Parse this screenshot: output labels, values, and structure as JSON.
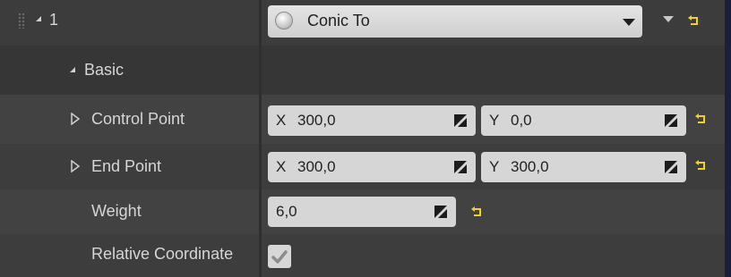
{
  "header": {
    "index_label": "1",
    "type_value": "Conic To"
  },
  "category": {
    "label": "Basic"
  },
  "properties": {
    "control_point": {
      "label": "Control Point",
      "x_axis": "X",
      "x_value": "300,0",
      "y_axis": "Y",
      "y_value": "0,0"
    },
    "end_point": {
      "label": "End Point",
      "x_axis": "X",
      "x_value": "300,0",
      "y_axis": "Y",
      "y_value": "300,0"
    },
    "weight": {
      "label": "Weight",
      "value": "6,0"
    },
    "relative_coordinates": {
      "label": "Relative Coordinate",
      "checked": true
    }
  },
  "colors": {
    "reset_arrow": "#f0d21c",
    "panel": "#4a4a4a",
    "field": "#d6d6d6",
    "frame": "#19203a"
  },
  "icons": [
    "grip-icon",
    "expand-arrow-icon",
    "radio-icon",
    "dropdown-caret-icon",
    "reset-to-default-icon",
    "drag-handle-icon",
    "checkmark-icon"
  ]
}
